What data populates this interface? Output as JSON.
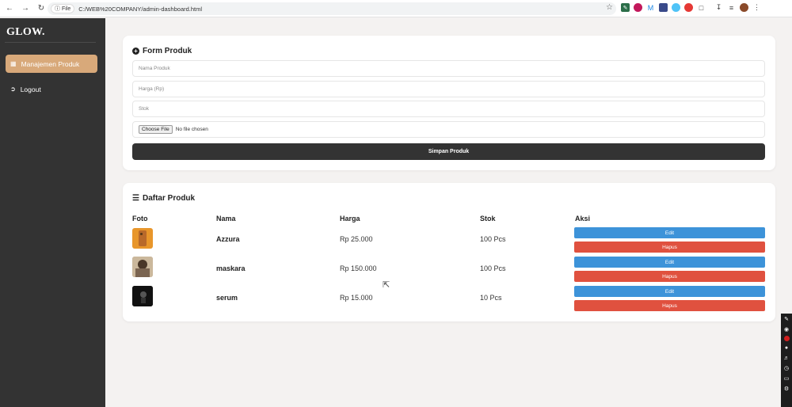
{
  "browser": {
    "file_chip": "File",
    "url": "C:/WEB%20COMPANY/admin-dashboard.html"
  },
  "sidebar": {
    "brand": "GLOW.",
    "items": [
      {
        "label": "Manajemen Produk",
        "icon": "box-icon",
        "active": true
      },
      {
        "label": "Logout",
        "icon": "logout-icon",
        "active": false
      }
    ]
  },
  "form": {
    "title": "Form Produk",
    "name_placeholder": "Nama Produk",
    "price_placeholder": "Harga (Rp)",
    "stock_placeholder": "Stok",
    "choose_file_label": "Choose File",
    "no_file_text": "No file chosen",
    "save_label": "Simpan Produk"
  },
  "list": {
    "title": "Daftar Produk",
    "headers": {
      "photo": "Foto",
      "name": "Nama",
      "price": "Harga",
      "stock": "Stok",
      "action": "Aksi"
    },
    "rows": [
      {
        "name": "Azzura",
        "price": "Rp 25.000",
        "stock": "100 Pcs",
        "edit": "Edit",
        "delete": "Hapus",
        "thumb_color": "#e8962b"
      },
      {
        "name": "maskara",
        "price": "Rp 150.000",
        "stock": "100 Pcs",
        "edit": "Edit",
        "delete": "Hapus",
        "thumb_color": "#6b5440"
      },
      {
        "name": "serum",
        "price": "Rp 15.000",
        "stock": "10 Pcs",
        "edit": "Edit",
        "delete": "Hapus",
        "thumb_color": "#111111"
      }
    ]
  },
  "colors": {
    "sidebar_bg": "#333333",
    "accent": "#d8a97a",
    "edit": "#3d93d9",
    "delete": "#e0513f"
  }
}
